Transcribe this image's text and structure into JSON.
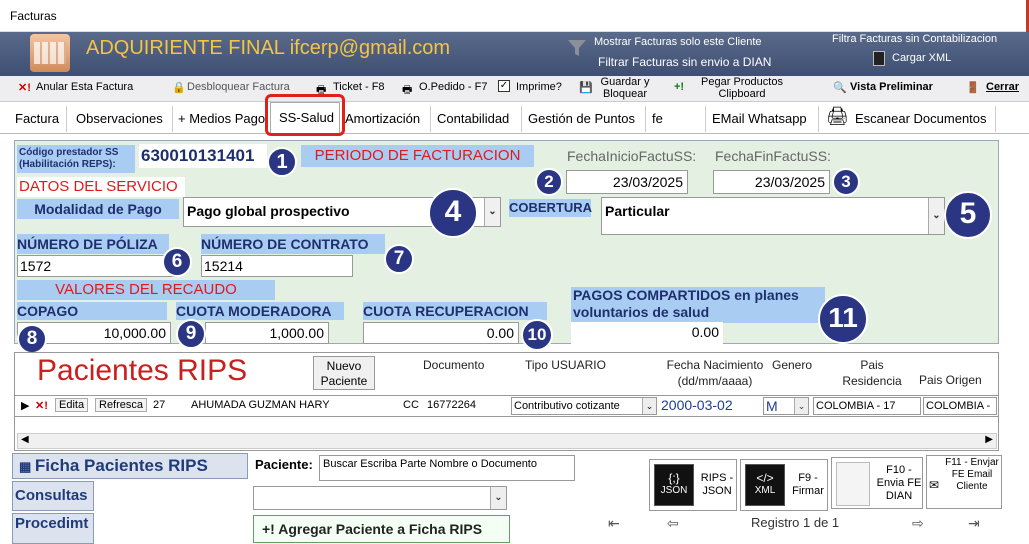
{
  "window": {
    "title": "Facturas"
  },
  "header": {
    "brand": "ADQUIRIENTE  FINAL ifcerp@gmail.com",
    "show_invoices_client": "Mostrar Facturas solo este Cliente",
    "filter_no_dian": "Filtrar Facturas sin envio a DIAN",
    "filter_no_accounting": "Filtra Facturas sin Contabilizacion",
    "load_xml": "Cargar XML"
  },
  "toolbar": {
    "cancel_invoice": "Anular Esta Factura",
    "unlock_invoice": "Desbloquear Factura",
    "ticket": "Ticket - F8",
    "order": "O.Pedido - F7",
    "print": "Imprime?",
    "save_lock": "Guardar y Bloquear",
    "paste_products": "Pegar Productos Clipboard",
    "preview": "Vista Preliminar",
    "close": "Cerrar"
  },
  "tabs": [
    "Factura",
    "Observaciones",
    "+ Medios Pago",
    "SS-Salud",
    "Amortización",
    "Contabilidad",
    "Gestión de Puntos",
    "fe",
    "EMail Whatsapp",
    "Escanear Documentos"
  ],
  "form": {
    "provider_code_label": "Código prestador SS (Habilitación REPS):",
    "provider_code": "630010131401",
    "period_label": "PERIODO DE FACTURACION",
    "start_label": "FechaInicioFactuSS:",
    "end_label": "FechaFinFactuSS:",
    "start_date": "23/03/2025",
    "end_date": "23/03/2025",
    "service_data_label": "DATOS DEL SERVICIO",
    "payment_mode_label": "Modalidad de Pago",
    "payment_mode": "Pago global prospectivo",
    "coverage_label": "COBERTURA",
    "coverage": "Particular",
    "policy_label": "NÚMERO DE PÓLIZA",
    "policy": "1572",
    "contract_label": "NÚMERO DE CONTRATO",
    "contract": "15214",
    "values_label": "VALORES DEL RECAUDO",
    "copay_label": "COPAGO",
    "copay": "10,000.00",
    "moderator_label": "CUOTA MODERADORA",
    "moderator": "1,000.00",
    "recovery_label": "CUOTA RECUPERACION",
    "recovery": "0.00",
    "shared_label": "PAGOS COMPARTIDOS en planes voluntarios de salud",
    "shared": "0.00",
    "badges": [
      "1",
      "2",
      "3",
      "4",
      "5",
      "6",
      "7",
      "8",
      "9",
      "10",
      "11"
    ]
  },
  "grid": {
    "title": "Pacientes RIPS",
    "new_patient": "Nuevo Paciente",
    "headers": {
      "documento": "Documento",
      "tipo_usuario": "Tipo USUARIO",
      "fecha_nac": "Fecha Nacimiento (dd/mm/aaaa)",
      "genero": "Genero",
      "pais_res": "Pais Residencia",
      "pais_origen": "Pais Origen"
    },
    "row": {
      "edit": "Edita",
      "refresh": "Refresca",
      "id": "27",
      "name": "AHUMADA GUZMAN HARY",
      "doc_type": "CC",
      "doc": "16772264",
      "user_type": "Contributivo cotizante",
      "birth": "2000-03-02",
      "gender": "M",
      "country_res": "COLOMBIA - 17",
      "country_origin": "COLOMBIA -"
    }
  },
  "bottom": {
    "sheet_button": "Ficha Pacientes RIPS",
    "consultas": "Consultas",
    "procedimientos": "Procedimt",
    "patient_label": "Paciente:",
    "search_hint": "Buscar Escriba Parte Nombre o Documento",
    "add_patient": "+! Agregar Paciente a Ficha RIPS",
    "rips_json": "RIPS - JSON",
    "json_icon": "JSON",
    "xml_icon": "XML",
    "f9": "F9 - Firmar",
    "f10": "F10 - Envia FE DIAN",
    "f11": "F11 - Envjar FE Email Cliente",
    "record": "Registro 1 de 1"
  }
}
